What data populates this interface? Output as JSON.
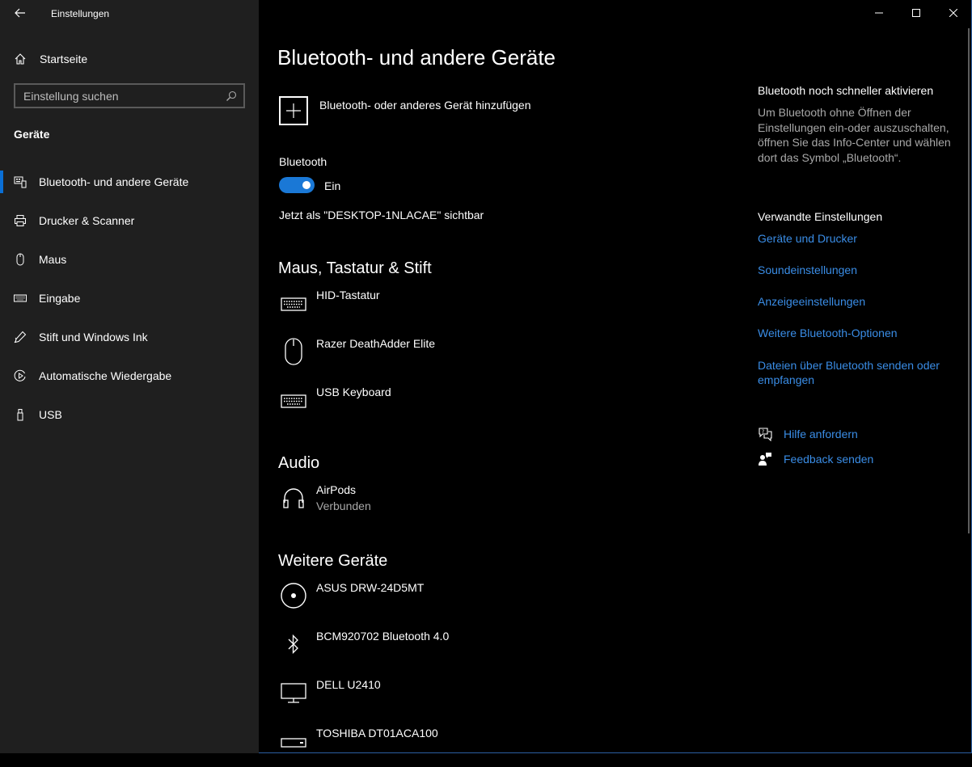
{
  "window": {
    "app_title": "Einstellungen",
    "controls": [
      "minimize-icon",
      "maximize-icon",
      "close-icon"
    ]
  },
  "sidebar": {
    "home_label": "Startseite",
    "search_placeholder": "Einstellung suchen",
    "section_label": "Geräte",
    "items": [
      {
        "label": "Bluetooth- und andere Geräte",
        "icon": "bluetooth-devices-icon",
        "active": true
      },
      {
        "label": "Drucker & Scanner",
        "icon": "printer-icon"
      },
      {
        "label": "Maus",
        "icon": "mouse-icon"
      },
      {
        "label": "Eingabe",
        "icon": "keyboard-icon"
      },
      {
        "label": "Stift und Windows Ink",
        "icon": "pen-icon"
      },
      {
        "label": "Automatische Wiedergabe",
        "icon": "autoplay-icon"
      },
      {
        "label": "USB",
        "icon": "usb-icon"
      }
    ]
  },
  "main": {
    "title": "Bluetooth- und andere Geräte",
    "add_device_label": "Bluetooth- oder anderes Gerät hinzufügen",
    "bluetooth_label": "Bluetooth",
    "bluetooth_toggle_state": "Ein",
    "bluetooth_on": true,
    "visible_as": "Jetzt als \"DESKTOP-1NLACAE\" sichtbar",
    "groups": [
      {
        "heading": "Maus, Tastatur & Stift",
        "devices": [
          {
            "name": "HID-Tastatur",
            "icon": "keyboard-icon"
          },
          {
            "name": "Razer DeathAdder Elite",
            "icon": "mouse-icon"
          },
          {
            "name": "USB Keyboard",
            "icon": "keyboard-icon"
          }
        ]
      },
      {
        "heading": "Audio",
        "devices": [
          {
            "name": "AirPods",
            "status": "Verbunden",
            "icon": "headphones-icon"
          }
        ]
      },
      {
        "heading": "Weitere Geräte",
        "devices": [
          {
            "name": "ASUS DRW-24D5MT",
            "icon": "optical-drive-icon"
          },
          {
            "name": "BCM920702 Bluetooth 4.0",
            "icon": "bluetooth-icon"
          },
          {
            "name": "DELL U2410",
            "icon": "monitor-icon"
          },
          {
            "name": "TOSHIBA DT01ACA100",
            "icon": "hard-drive-icon"
          }
        ]
      }
    ]
  },
  "right": {
    "quick_heading": "Bluetooth noch schneller aktivieren",
    "quick_text": "Um Bluetooth ohne Öffnen der Einstellungen ein-oder auszuschalten, öffnen Sie das Info-Center und wählen dort das Symbol „Bluetooth“.",
    "related_heading": "Verwandte Einstellungen",
    "related_links": [
      "Geräte und Drucker",
      "Soundeinstellungen",
      "Anzeigeeinstellungen",
      "Weitere Bluetooth-Optionen",
      "Dateien über Bluetooth senden oder empfangen"
    ],
    "help": [
      {
        "label": "Hilfe anfordern",
        "icon": "help-chat-icon"
      },
      {
        "label": "Feedback senden",
        "icon": "feedback-icon"
      }
    ]
  },
  "colors": {
    "accent": "#0a6fd6",
    "link": "#3a8de6",
    "sidebar_bg": "#1f1f1f",
    "content_bg": "#000000"
  }
}
